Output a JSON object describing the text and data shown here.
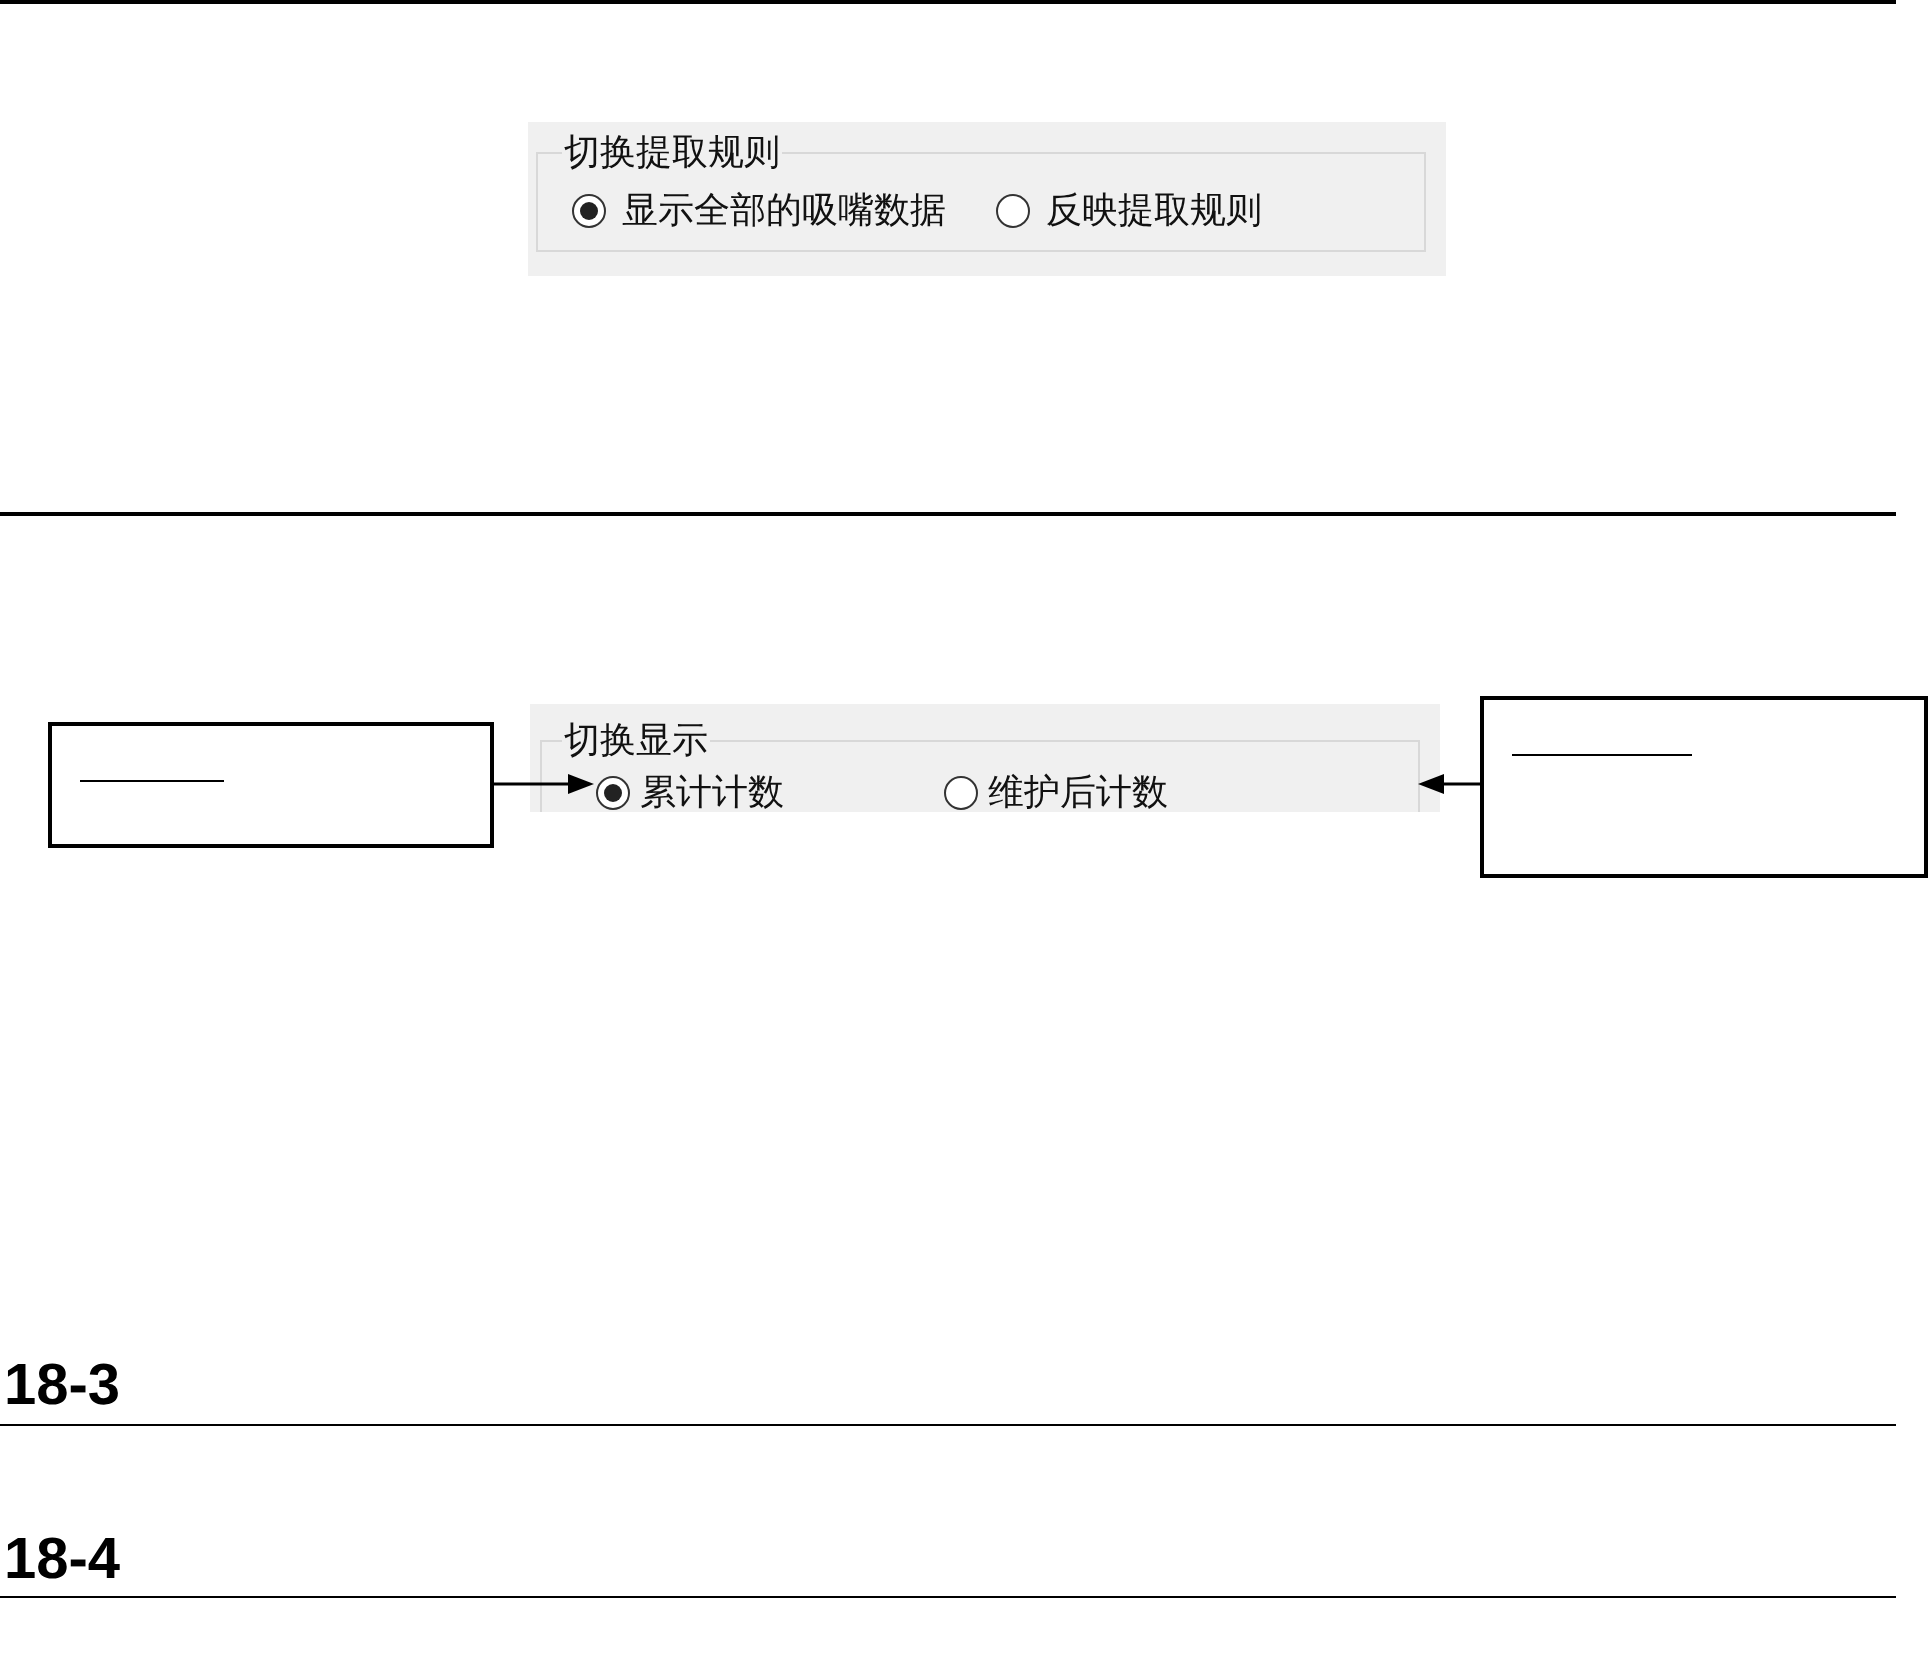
{
  "figures": [
    {
      "group": {
        "title": "切换提取规则",
        "options": [
          {
            "label": "显示全部的吸嘴数据",
            "selected": true
          },
          {
            "label": "反映提取规则",
            "selected": false
          }
        ]
      }
    },
    {
      "group": {
        "title": "切换显示",
        "options": [
          {
            "label": "累计计数",
            "selected": true
          },
          {
            "label": "维护后计数",
            "selected": false
          }
        ]
      }
    }
  ],
  "sections": [
    {
      "heading": "18-3"
    },
    {
      "heading": "18-4"
    }
  ]
}
